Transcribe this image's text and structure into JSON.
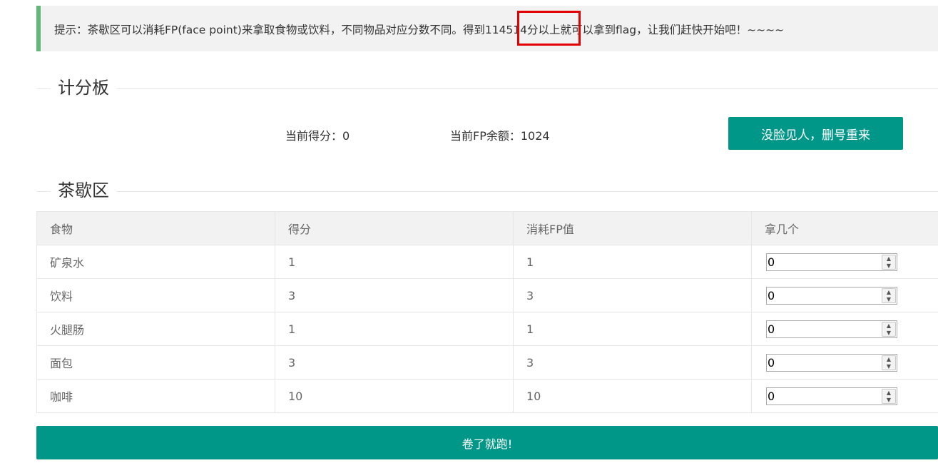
{
  "hint": {
    "prefix": "提示：茶歇区可以消耗FP(face point)来拿取食物或饮料，不同物品对应分数不同。得到",
    "target": "114514分",
    "suffix": "以上就可以拿到flag，让我们赶快开始吧！~~~~"
  },
  "scoreboard": {
    "title": "计分板",
    "score_label": "当前得分：0",
    "fp_label": "当前FP余额：1024",
    "reset_button": "没脸见人，删号重来"
  },
  "shop": {
    "title": "茶歇区",
    "columns": [
      "食物",
      "得分",
      "消耗FP值",
      "拿几个"
    ],
    "rows": [
      {
        "food": "矿泉水",
        "score": "1",
        "cost": "1",
        "qty": "0"
      },
      {
        "food": "饮料",
        "score": "3",
        "cost": "3",
        "qty": "0"
      },
      {
        "food": "火腿肠",
        "score": "1",
        "cost": "1",
        "qty": "0"
      },
      {
        "food": "面包",
        "score": "3",
        "cost": "3",
        "qty": "0"
      },
      {
        "food": "咖啡",
        "score": "10",
        "cost": "10",
        "qty": "0"
      }
    ],
    "submit_button": "卷了就跑!"
  },
  "colors": {
    "primary": "#009688",
    "hint_border": "#5fb878",
    "highlight": "#e30000"
  },
  "icons": {
    "spinner_up": "chevron-up-icon",
    "spinner_down": "chevron-down-icon"
  }
}
